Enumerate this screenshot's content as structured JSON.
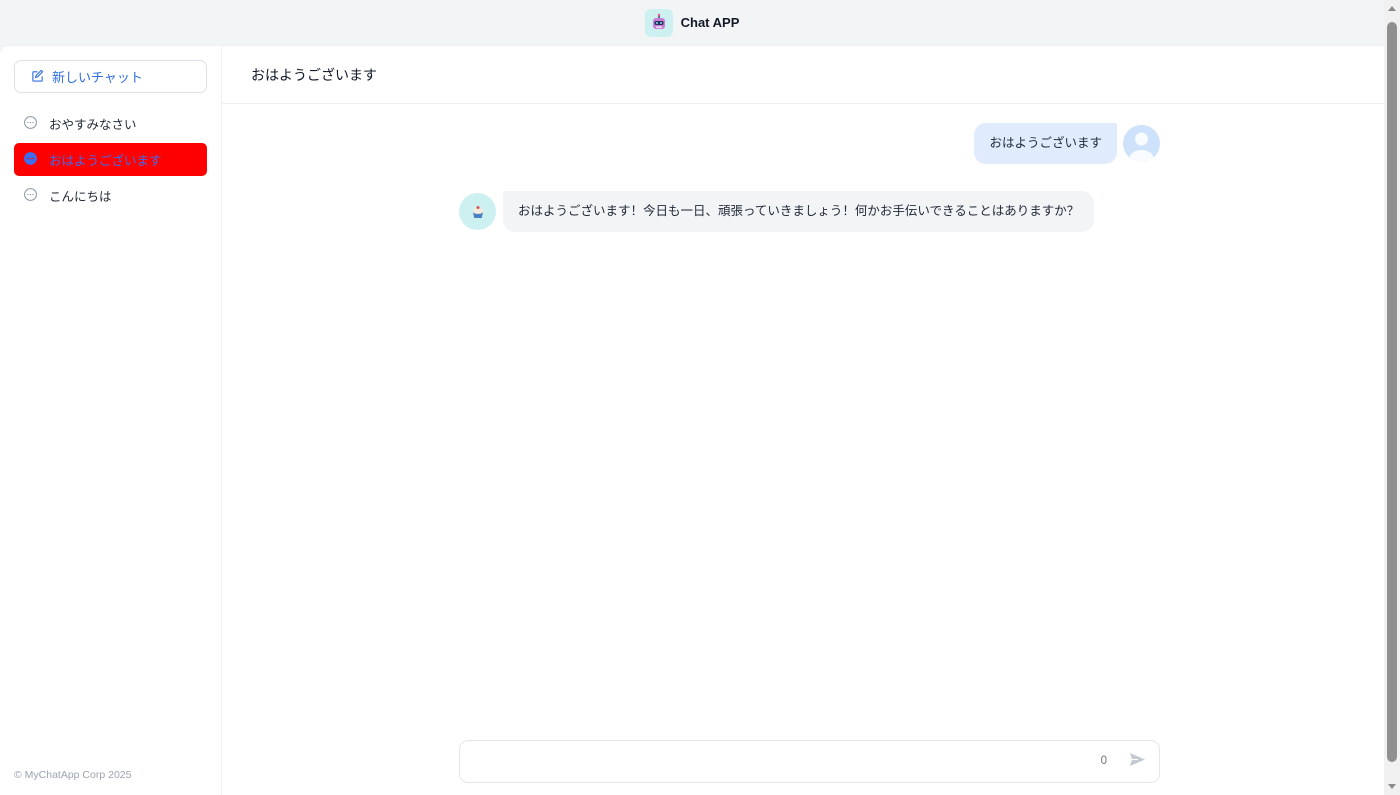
{
  "app": {
    "title": "Chat APP"
  },
  "sidebar": {
    "new_chat_label": "新しいチャット",
    "conversations": [
      {
        "label": "おやすみなさい",
        "active": false
      },
      {
        "label": "おはようございます",
        "active": true
      },
      {
        "label": "こんにちは",
        "active": false
      }
    ],
    "footer": "© MyChatApp Corp 2025"
  },
  "main": {
    "header_title": "おはようございます",
    "messages": [
      {
        "role": "user",
        "text": "おはようございます"
      },
      {
        "role": "assistant",
        "text": "おはようございます！今日も一日、頑張っていきましょう！何かお手伝いできることはありますか？"
      }
    ],
    "input": {
      "value": "",
      "placeholder": "",
      "char_count": "0"
    }
  },
  "colors": {
    "accent": "#2f6fe0",
    "active_item_bg": "#ff0000",
    "user_bubble": "#e0ecfd",
    "bot_bubble": "#f3f4f6"
  }
}
